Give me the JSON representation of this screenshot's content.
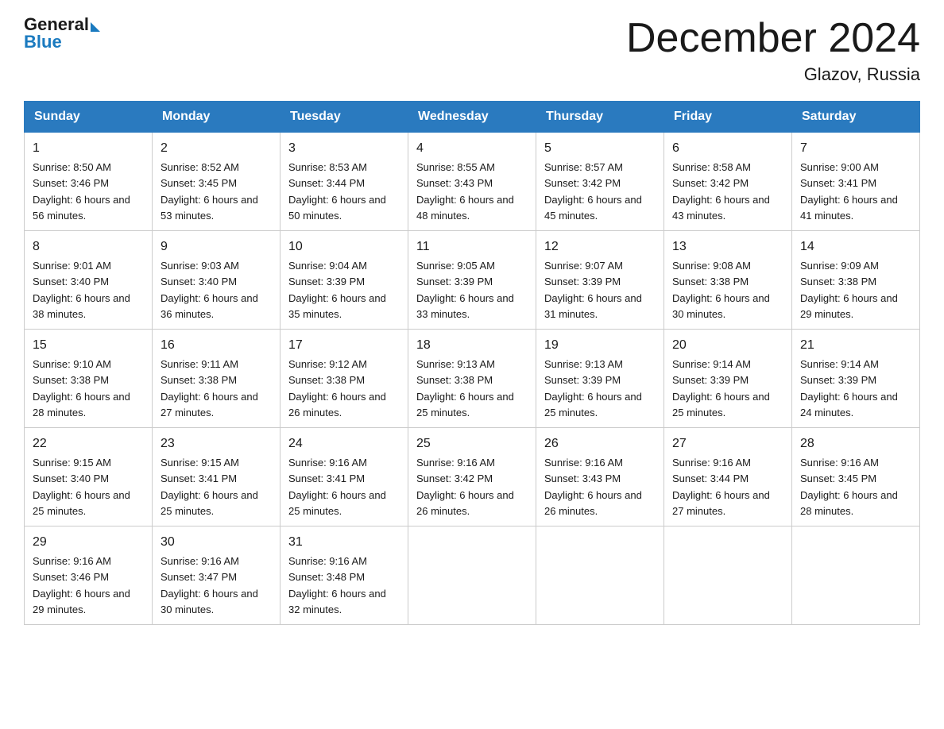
{
  "header": {
    "logo_general": "General",
    "logo_blue": "Blue",
    "title": "December 2024",
    "location": "Glazov, Russia"
  },
  "days_of_week": [
    "Sunday",
    "Monday",
    "Tuesday",
    "Wednesday",
    "Thursday",
    "Friday",
    "Saturday"
  ],
  "weeks": [
    [
      {
        "day": "1",
        "sunrise": "8:50 AM",
        "sunset": "3:46 PM",
        "daylight": "6 hours and 56 minutes."
      },
      {
        "day": "2",
        "sunrise": "8:52 AM",
        "sunset": "3:45 PM",
        "daylight": "6 hours and 53 minutes."
      },
      {
        "day": "3",
        "sunrise": "8:53 AM",
        "sunset": "3:44 PM",
        "daylight": "6 hours and 50 minutes."
      },
      {
        "day": "4",
        "sunrise": "8:55 AM",
        "sunset": "3:43 PM",
        "daylight": "6 hours and 48 minutes."
      },
      {
        "day": "5",
        "sunrise": "8:57 AM",
        "sunset": "3:42 PM",
        "daylight": "6 hours and 45 minutes."
      },
      {
        "day": "6",
        "sunrise": "8:58 AM",
        "sunset": "3:42 PM",
        "daylight": "6 hours and 43 minutes."
      },
      {
        "day": "7",
        "sunrise": "9:00 AM",
        "sunset": "3:41 PM",
        "daylight": "6 hours and 41 minutes."
      }
    ],
    [
      {
        "day": "8",
        "sunrise": "9:01 AM",
        "sunset": "3:40 PM",
        "daylight": "6 hours and 38 minutes."
      },
      {
        "day": "9",
        "sunrise": "9:03 AM",
        "sunset": "3:40 PM",
        "daylight": "6 hours and 36 minutes."
      },
      {
        "day": "10",
        "sunrise": "9:04 AM",
        "sunset": "3:39 PM",
        "daylight": "6 hours and 35 minutes."
      },
      {
        "day": "11",
        "sunrise": "9:05 AM",
        "sunset": "3:39 PM",
        "daylight": "6 hours and 33 minutes."
      },
      {
        "day": "12",
        "sunrise": "9:07 AM",
        "sunset": "3:39 PM",
        "daylight": "6 hours and 31 minutes."
      },
      {
        "day": "13",
        "sunrise": "9:08 AM",
        "sunset": "3:38 PM",
        "daylight": "6 hours and 30 minutes."
      },
      {
        "day": "14",
        "sunrise": "9:09 AM",
        "sunset": "3:38 PM",
        "daylight": "6 hours and 29 minutes."
      }
    ],
    [
      {
        "day": "15",
        "sunrise": "9:10 AM",
        "sunset": "3:38 PM",
        "daylight": "6 hours and 28 minutes."
      },
      {
        "day": "16",
        "sunrise": "9:11 AM",
        "sunset": "3:38 PM",
        "daylight": "6 hours and 27 minutes."
      },
      {
        "day": "17",
        "sunrise": "9:12 AM",
        "sunset": "3:38 PM",
        "daylight": "6 hours and 26 minutes."
      },
      {
        "day": "18",
        "sunrise": "9:13 AM",
        "sunset": "3:38 PM",
        "daylight": "6 hours and 25 minutes."
      },
      {
        "day": "19",
        "sunrise": "9:13 AM",
        "sunset": "3:39 PM",
        "daylight": "6 hours and 25 minutes."
      },
      {
        "day": "20",
        "sunrise": "9:14 AM",
        "sunset": "3:39 PM",
        "daylight": "6 hours and 25 minutes."
      },
      {
        "day": "21",
        "sunrise": "9:14 AM",
        "sunset": "3:39 PM",
        "daylight": "6 hours and 24 minutes."
      }
    ],
    [
      {
        "day": "22",
        "sunrise": "9:15 AM",
        "sunset": "3:40 PM",
        "daylight": "6 hours and 25 minutes."
      },
      {
        "day": "23",
        "sunrise": "9:15 AM",
        "sunset": "3:41 PM",
        "daylight": "6 hours and 25 minutes."
      },
      {
        "day": "24",
        "sunrise": "9:16 AM",
        "sunset": "3:41 PM",
        "daylight": "6 hours and 25 minutes."
      },
      {
        "day": "25",
        "sunrise": "9:16 AM",
        "sunset": "3:42 PM",
        "daylight": "6 hours and 26 minutes."
      },
      {
        "day": "26",
        "sunrise": "9:16 AM",
        "sunset": "3:43 PM",
        "daylight": "6 hours and 26 minutes."
      },
      {
        "day": "27",
        "sunrise": "9:16 AM",
        "sunset": "3:44 PM",
        "daylight": "6 hours and 27 minutes."
      },
      {
        "day": "28",
        "sunrise": "9:16 AM",
        "sunset": "3:45 PM",
        "daylight": "6 hours and 28 minutes."
      }
    ],
    [
      {
        "day": "29",
        "sunrise": "9:16 AM",
        "sunset": "3:46 PM",
        "daylight": "6 hours and 29 minutes."
      },
      {
        "day": "30",
        "sunrise": "9:16 AM",
        "sunset": "3:47 PM",
        "daylight": "6 hours and 30 minutes."
      },
      {
        "day": "31",
        "sunrise": "9:16 AM",
        "sunset": "3:48 PM",
        "daylight": "6 hours and 32 minutes."
      },
      null,
      null,
      null,
      null
    ]
  ]
}
